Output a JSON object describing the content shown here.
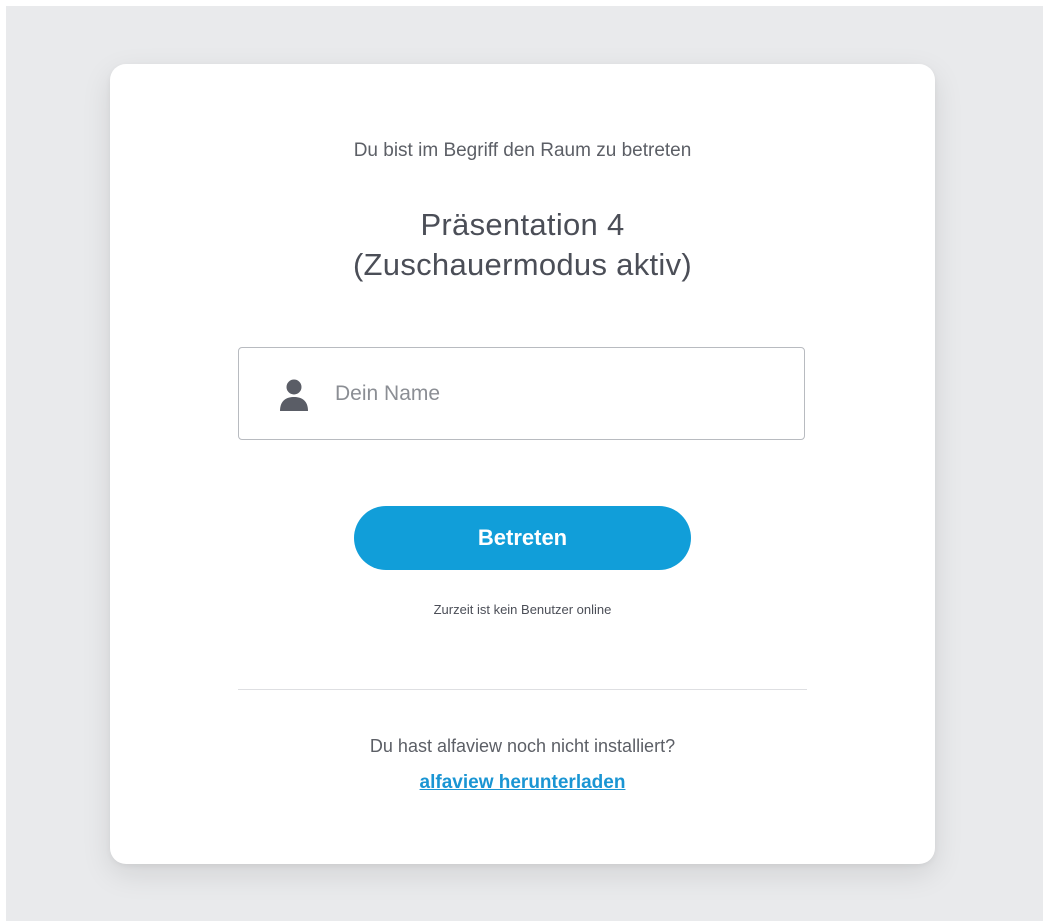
{
  "intro_text": "Du bist im Begriff den Raum zu betreten",
  "room": {
    "title_line1": "Präsentation 4",
    "title_line2": "(Zuschauermodus aktiv)"
  },
  "name_field": {
    "placeholder": "Dein Name",
    "value": "",
    "icon": "user-icon"
  },
  "enter_button": {
    "label": "Betreten"
  },
  "status_text": "Zurzeit ist kein Benutzer online",
  "install": {
    "question": "Du hast alfaview noch nicht installiert?",
    "download_label": "alfaview herunterladen"
  },
  "colors": {
    "accent": "#119ed9",
    "link": "#1a95d3",
    "background": "#e9eaec",
    "card": "#ffffff"
  }
}
